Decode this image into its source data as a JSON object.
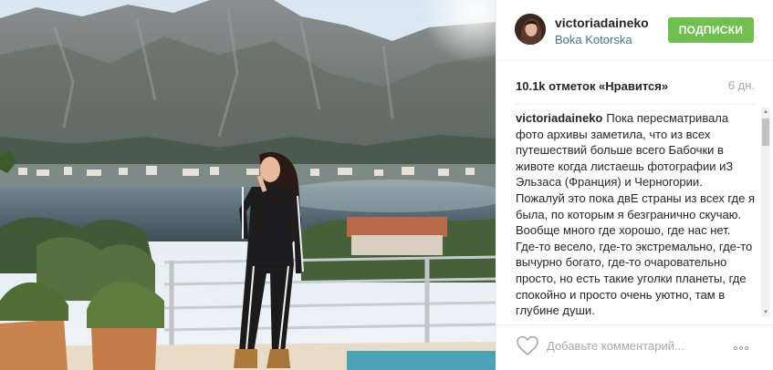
{
  "post": {
    "username": "victoriadaineko",
    "location": "Boka Kotorska",
    "follow_label": "ПОДПИСКИ",
    "likes": "10.1k отметок «Нравится»",
    "age": "6 дн.",
    "caption_user": "victoriadaineko",
    "caption_text": "Пока пересматривала фото архивы заметила, что из всех путешествий больше всего Бабочки в животе когда листаешь фотографии иЗ Эльзаса (Франция) и Черногории. Пожалуй это пока двЕ страны из всех где я была, по которым я безгранично скучаю. Вообще много где хорошо, где нас нет. Где-то весело, где-то экстремально, где-то вычурно богато, где-то очаровательно просто, но есть такие уголки планеты, где спокойно и просто очень уютно, там в глубине души."
  },
  "footer": {
    "comment_placeholder": "Добавьте комментарий..."
  },
  "icons": {
    "like": "heart-icon",
    "more": "more-options-icon"
  },
  "colors": {
    "follow_button": "#70c050",
    "location_link": "#3f729b",
    "muted_text": "#a5a7aa"
  }
}
